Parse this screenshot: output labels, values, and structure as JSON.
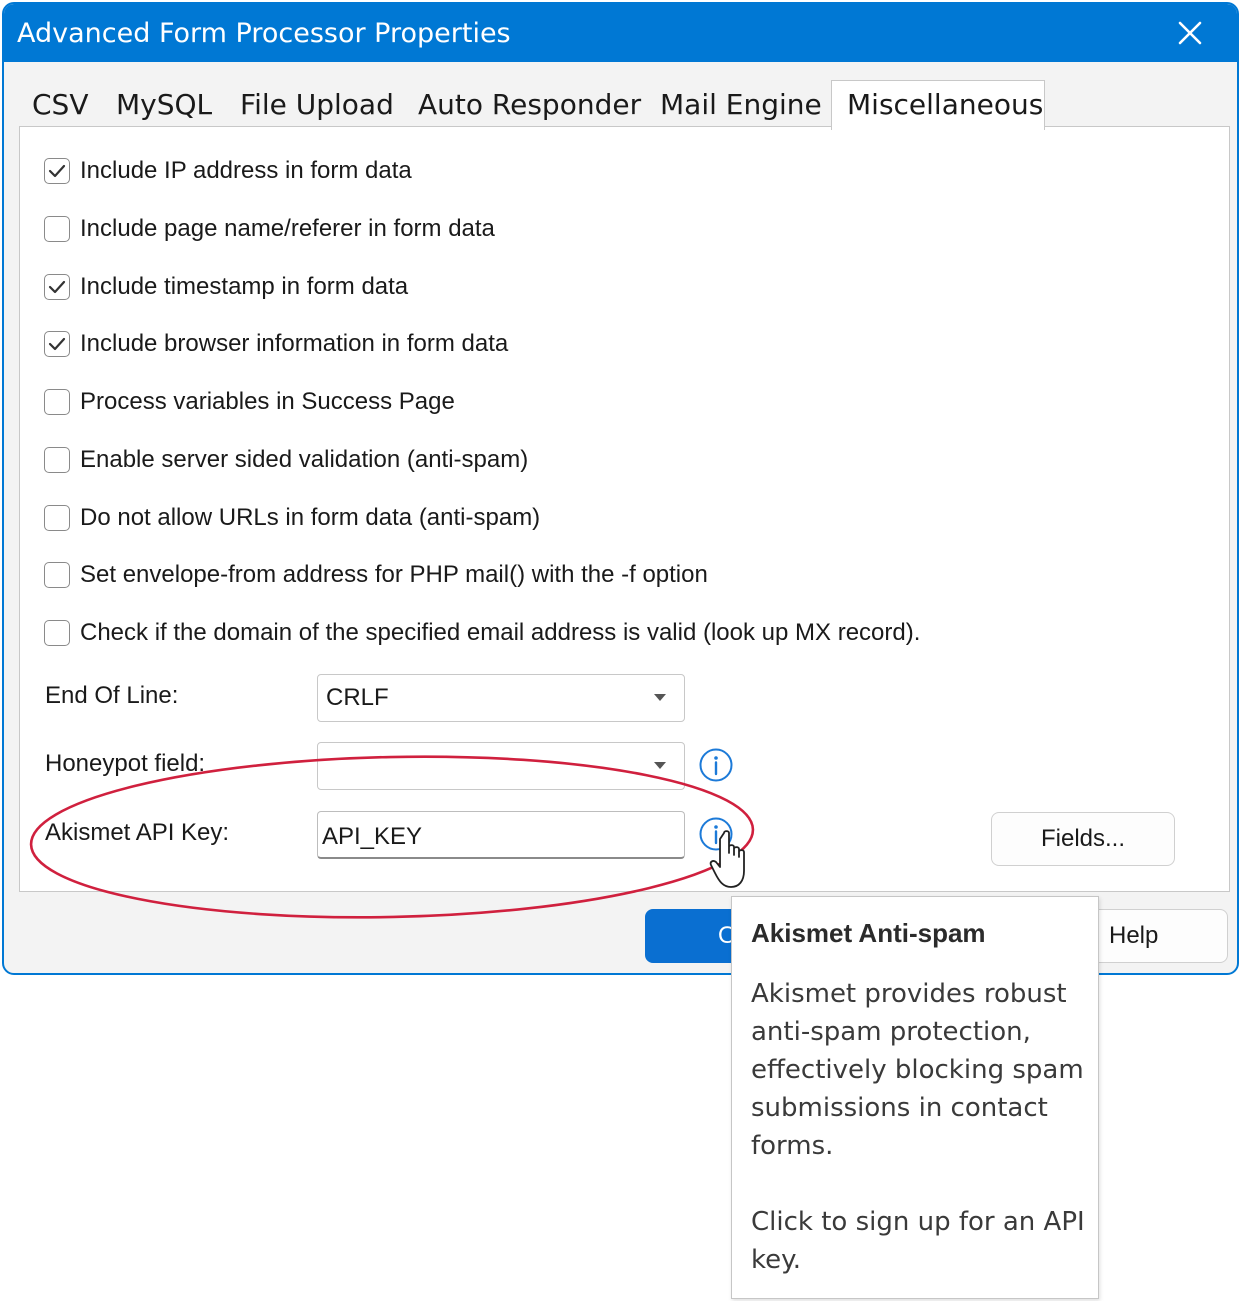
{
  "window": {
    "title": "Advanced Form Processor Properties"
  },
  "tabs": [
    {
      "label": "CSV"
    },
    {
      "label": "MySQL"
    },
    {
      "label": "File Upload"
    },
    {
      "label": "Auto Responder"
    },
    {
      "label": "Mail Engine"
    },
    {
      "label": "Miscellaneous",
      "active": true
    }
  ],
  "options": [
    {
      "label": "Include IP address in form data",
      "checked": true
    },
    {
      "label": "Include page name/referer in form data",
      "checked": false
    },
    {
      "label": "Include timestamp in form data",
      "checked": true
    },
    {
      "label": "Include browser information in form data",
      "checked": true
    },
    {
      "label": "Process variables in Success Page",
      "checked": false
    },
    {
      "label": "Enable server sided validation (anti-spam)",
      "checked": false
    },
    {
      "label": "Do not allow URLs in form data (anti-spam)",
      "checked": false
    },
    {
      "label": "Set envelope-from address for PHP mail() with the -f option",
      "checked": false
    },
    {
      "label": "Check if the domain of the specified email address is valid (look up MX record).",
      "checked": false
    }
  ],
  "fields": {
    "end_of_line": {
      "label": "End Of Line:",
      "value": "CRLF"
    },
    "honeypot": {
      "label": "Honeypot field:",
      "value": ""
    },
    "akismet": {
      "label": "Akismet API Key:",
      "value": "API_KEY"
    }
  },
  "buttons": {
    "fields": "Fields...",
    "ok": "OK",
    "help": "Help"
  },
  "tooltip": {
    "title": "Akismet Anti-spam",
    "body": "Akismet provides robust anti-spam protection, effectively blocking spam submissions in contact forms.",
    "link_hint": "Click to sign up for an API key."
  },
  "colors": {
    "accent": "#0078d4",
    "annotation": "#d0203e"
  }
}
